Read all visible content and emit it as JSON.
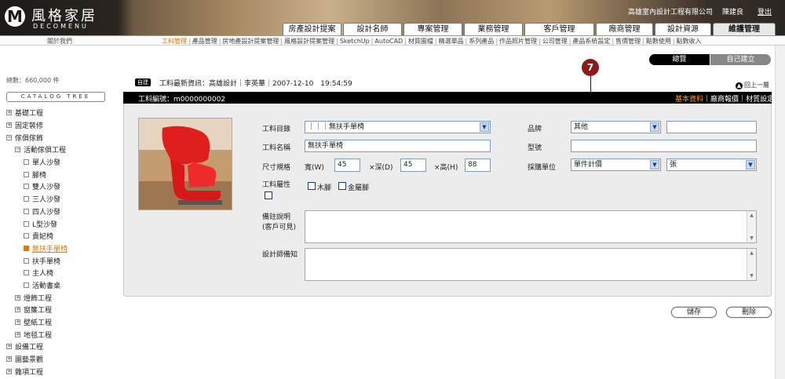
{
  "header": {
    "logo_letter": "M",
    "brand_cn": "風格家居",
    "brand_en": "DECOMENU",
    "company": "高雄室內設計工程有限公司",
    "user": "陳建良",
    "logout": "登出",
    "nav_tabs": [
      "房產設計提案",
      "設計名師",
      "專案管理",
      "業務管理",
      "客戶管理",
      "廠商管理",
      "設計資源",
      "維護管理"
    ]
  },
  "subnav": {
    "about": "關於我們",
    "links": [
      "工料管理",
      "產品管理",
      "房地產設計提案管理",
      "風格設計提案管理",
      "SketchUp",
      "AutoCAD",
      "材質圖檔",
      "精選單品",
      "系列產品",
      "作品照片管理",
      "公司管理",
      "產品系統設定",
      "售價管理",
      "點數使用",
      "點數收入"
    ],
    "active_index": 0
  },
  "sidebar": {
    "total": "總數：660,000 件",
    "catalog_tree": "CATALOG TREE",
    "tree": [
      {
        "label": "基礎工程",
        "indent": 0,
        "icon": "plus"
      },
      {
        "label": "固定裝修",
        "indent": 0,
        "icon": "plus"
      },
      {
        "label": "傢俱傢飾",
        "indent": 0,
        "icon": "minus"
      },
      {
        "label": "活動傢俱工程",
        "indent": 1,
        "icon": "minus"
      },
      {
        "label": "單人沙發",
        "indent": 2,
        "icon": "square"
      },
      {
        "label": "腳椅",
        "indent": 2,
        "icon": "square"
      },
      {
        "label": "雙人沙發",
        "indent": 2,
        "icon": "square"
      },
      {
        "label": "三人沙發",
        "indent": 2,
        "icon": "square"
      },
      {
        "label": "四人沙發",
        "indent": 2,
        "icon": "square"
      },
      {
        "label": "L型沙發",
        "indent": 2,
        "icon": "square"
      },
      {
        "label": "貴妃椅",
        "indent": 2,
        "icon": "square"
      },
      {
        "label": "無扶手單椅",
        "indent": 2,
        "icon": "square",
        "active": true
      },
      {
        "label": "扶手單椅",
        "indent": 2,
        "icon": "square"
      },
      {
        "label": "主人椅",
        "indent": 2,
        "icon": "square"
      },
      {
        "label": "活動書桌",
        "indent": 2,
        "icon": "square"
      },
      {
        "label": "燈飾工程",
        "indent": 1,
        "icon": "plus"
      },
      {
        "label": "窗簾工程",
        "indent": 1,
        "icon": "plus"
      },
      {
        "label": "壁紙工程",
        "indent": 1,
        "icon": "plus"
      },
      {
        "label": "地毯工程",
        "indent": 1,
        "icon": "plus"
      },
      {
        "label": "設備工程",
        "indent": 0,
        "icon": "plus"
      },
      {
        "label": "園藝景觀",
        "indent": 0,
        "icon": "plus"
      },
      {
        "label": "雜項工程",
        "indent": 0,
        "icon": "plus"
      }
    ]
  },
  "view_tabs": {
    "total": "總覽",
    "self": "自己建立"
  },
  "marker": "7",
  "news": {
    "badge": "自建",
    "text": "工料最新資訊：高雄設計｜李英華｜2007-12-10　19:54:59"
  },
  "back_link": "回上一層",
  "panel": {
    "title": "工料編號：m0000000002",
    "links": [
      "基本資料",
      "廠商報價",
      "材質設定"
    ],
    "form": {
      "catalog_label": "工料目錄",
      "catalog_value": "｜｜｜無扶手單椅",
      "name_label": "工料名稱",
      "name_value": "無扶手單椅",
      "size_label": "尺寸規格",
      "width_label": "寬(W)",
      "width_value": "45",
      "depth_label": "×深(D)",
      "depth_value": "45",
      "height_label": "×高(H)",
      "height_value": "88",
      "attr_label": "工料屬性",
      "attr_wood": "木腳",
      "attr_metal": "金屬腳",
      "brand_label": "品牌",
      "brand_value": "其他",
      "model_label": "型號",
      "purchase_label": "採購單位",
      "purchase_value": "單件計價",
      "unit_value": "張",
      "remark_label_1": "備註說明",
      "remark_label_2": "(客戶可見)",
      "designer_note_label": "設計師備知"
    }
  },
  "buttons": {
    "save": "儲存",
    "delete": "刪除"
  }
}
